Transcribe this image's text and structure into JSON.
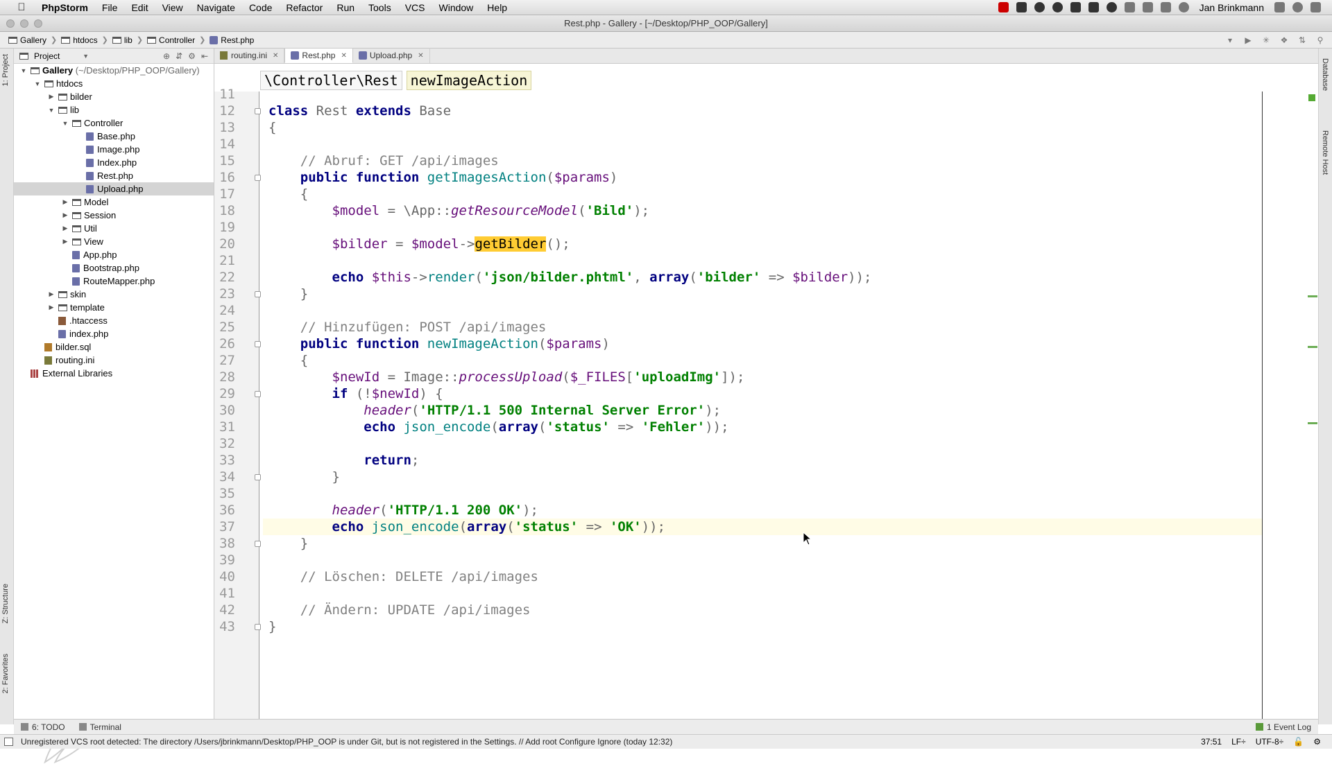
{
  "menubar": {
    "app": "PhpStorm",
    "items": [
      "File",
      "Edit",
      "View",
      "Navigate",
      "Code",
      "Refactor",
      "Run",
      "Tools",
      "VCS",
      "Window",
      "Help"
    ],
    "user": "Jan Brinkmann"
  },
  "window": {
    "title": "Rest.php - Gallery - [~/Desktop/PHP_OOP/Gallery]"
  },
  "navbar": {
    "crumbs": [
      "Gallery",
      "htdocs",
      "lib",
      "Controller",
      "Rest.php"
    ]
  },
  "project": {
    "header": "Project",
    "root_name": "Gallery",
    "root_path": "(~/Desktop/PHP_OOP/Gallery)",
    "tree": [
      {
        "label": "htdocs",
        "type": "folder",
        "depth": 1,
        "open": true
      },
      {
        "label": "bilder",
        "type": "folder",
        "depth": 2,
        "open": false
      },
      {
        "label": "lib",
        "type": "folder",
        "depth": 2,
        "open": true
      },
      {
        "label": "Controller",
        "type": "folder",
        "depth": 3,
        "open": true
      },
      {
        "label": "Base.php",
        "type": "php",
        "depth": 4
      },
      {
        "label": "Image.php",
        "type": "php",
        "depth": 4
      },
      {
        "label": "Index.php",
        "type": "php",
        "depth": 4
      },
      {
        "label": "Rest.php",
        "type": "php",
        "depth": 4
      },
      {
        "label": "Upload.php",
        "type": "php",
        "depth": 4,
        "selected": true
      },
      {
        "label": "Model",
        "type": "folder",
        "depth": 3,
        "open": false
      },
      {
        "label": "Session",
        "type": "folder",
        "depth": 3,
        "open": false
      },
      {
        "label": "Util",
        "type": "folder",
        "depth": 3,
        "open": false
      },
      {
        "label": "View",
        "type": "folder",
        "depth": 3,
        "open": false
      },
      {
        "label": "App.php",
        "type": "php",
        "depth": 3
      },
      {
        "label": "Bootstrap.php",
        "type": "php",
        "depth": 3
      },
      {
        "label": "RouteMapper.php",
        "type": "php",
        "depth": 3
      },
      {
        "label": "skin",
        "type": "folder",
        "depth": 2,
        "open": false
      },
      {
        "label": "template",
        "type": "folder",
        "depth": 2,
        "open": false
      },
      {
        "label": ".htaccess",
        "type": "ht",
        "depth": 2
      },
      {
        "label": "index.php",
        "type": "php",
        "depth": 2
      },
      {
        "label": "bilder.sql",
        "type": "sql",
        "depth": 1
      },
      {
        "label": "routing.ini",
        "type": "ini",
        "depth": 1
      },
      {
        "label": "External Libraries",
        "type": "lib",
        "depth": 0
      }
    ]
  },
  "tabs": [
    {
      "label": "routing.ini",
      "icon": "ini",
      "active": false
    },
    {
      "label": "Rest.php",
      "icon": "php",
      "active": true
    },
    {
      "label": "Upload.php",
      "icon": "php",
      "active": false
    }
  ],
  "editor": {
    "crumb_class": "\\Controller\\Rest",
    "crumb_method": "newImageAction",
    "caret_line": 37,
    "lines": [
      {
        "n": 11,
        "t": []
      },
      {
        "n": 12,
        "t": [
          [
            "kw",
            "class "
          ],
          [
            "cls",
            "Rest "
          ],
          [
            "kw",
            "extends "
          ],
          [
            "cls",
            "Base"
          ]
        ]
      },
      {
        "n": 13,
        "t": [
          [
            "cls",
            "{"
          ]
        ]
      },
      {
        "n": 14,
        "t": []
      },
      {
        "n": 15,
        "t": [
          [
            "",
            "    "
          ],
          [
            "cmt",
            "// Abruf: GET /api/images"
          ]
        ]
      },
      {
        "n": 16,
        "t": [
          [
            "",
            "    "
          ],
          [
            "kw",
            "public function "
          ],
          [
            "fn",
            "getImagesAction"
          ],
          [
            "cls",
            "("
          ],
          [
            "var",
            "$params"
          ],
          [
            "cls",
            ")"
          ]
        ]
      },
      {
        "n": 17,
        "t": [
          [
            "",
            "    "
          ],
          [
            "cls",
            "{"
          ]
        ]
      },
      {
        "n": 18,
        "t": [
          [
            "",
            "        "
          ],
          [
            "var",
            "$model "
          ],
          [
            "cls",
            "= \\App::"
          ],
          [
            "stat",
            "getResourceModel"
          ],
          [
            "cls",
            "("
          ],
          [
            "str",
            "'Bild'"
          ],
          [
            "cls",
            ");"
          ]
        ]
      },
      {
        "n": 19,
        "t": []
      },
      {
        "n": 20,
        "t": [
          [
            "",
            "        "
          ],
          [
            "var",
            "$bilder "
          ],
          [
            "cls",
            "= "
          ],
          [
            "var",
            "$model"
          ],
          [
            "cls",
            "->"
          ],
          [
            "hl",
            "getBilder"
          ],
          [
            "cls",
            "();"
          ]
        ]
      },
      {
        "n": 21,
        "t": []
      },
      {
        "n": 22,
        "t": [
          [
            "",
            "        "
          ],
          [
            "kw",
            "echo "
          ],
          [
            "var",
            "$this"
          ],
          [
            "cls",
            "->"
          ],
          [
            "fn",
            "render"
          ],
          [
            "cls",
            "("
          ],
          [
            "str",
            "'json/bilder.phtml'"
          ],
          [
            "cls",
            ", "
          ],
          [
            "kw",
            "array"
          ],
          [
            "cls",
            "("
          ],
          [
            "str",
            "'bilder'"
          ],
          [
            "cls",
            " => "
          ],
          [
            "var",
            "$bilder"
          ],
          [
            "cls",
            "));"
          ]
        ]
      },
      {
        "n": 23,
        "t": [
          [
            "",
            "    "
          ],
          [
            "cls",
            "}"
          ]
        ]
      },
      {
        "n": 24,
        "t": []
      },
      {
        "n": 25,
        "t": [
          [
            "",
            "    "
          ],
          [
            "cmt",
            "// Hinzufügen: POST /api/images"
          ]
        ]
      },
      {
        "n": 26,
        "t": [
          [
            "",
            "    "
          ],
          [
            "kw",
            "public function "
          ],
          [
            "fn",
            "newImageAction"
          ],
          [
            "cls",
            "("
          ],
          [
            "var",
            "$params"
          ],
          [
            "cls",
            ")"
          ]
        ]
      },
      {
        "n": 27,
        "t": [
          [
            "",
            "    "
          ],
          [
            "cls",
            "{"
          ]
        ]
      },
      {
        "n": 28,
        "t": [
          [
            "",
            "        "
          ],
          [
            "var",
            "$newId "
          ],
          [
            "cls",
            "= Image::"
          ],
          [
            "stat",
            "processUpload"
          ],
          [
            "cls",
            "("
          ],
          [
            "var",
            "$_FILES"
          ],
          [
            "cls",
            "["
          ],
          [
            "str",
            "'uploadImg'"
          ],
          [
            "cls",
            "]);"
          ]
        ]
      },
      {
        "n": 29,
        "t": [
          [
            "",
            "        "
          ],
          [
            "kw",
            "if "
          ],
          [
            "cls",
            "(!"
          ],
          [
            "var",
            "$newId"
          ],
          [
            "cls",
            ") {"
          ]
        ]
      },
      {
        "n": 30,
        "t": [
          [
            "",
            "            "
          ],
          [
            "stat",
            "header"
          ],
          [
            "cls",
            "("
          ],
          [
            "str",
            "'HTTP/1.1 500 Internal Server Error'"
          ],
          [
            "cls",
            ");"
          ]
        ]
      },
      {
        "n": 31,
        "t": [
          [
            "",
            "            "
          ],
          [
            "kw",
            "echo "
          ],
          [
            "fn",
            "json_encode"
          ],
          [
            "cls",
            "("
          ],
          [
            "kw",
            "array"
          ],
          [
            "cls",
            "("
          ],
          [
            "str",
            "'status'"
          ],
          [
            "cls",
            " => "
          ],
          [
            "str",
            "'Fehler'"
          ],
          [
            "cls",
            "));"
          ]
        ]
      },
      {
        "n": 32,
        "t": []
      },
      {
        "n": 33,
        "t": [
          [
            "",
            "            "
          ],
          [
            "kw",
            "return"
          ],
          [
            "cls",
            ";"
          ]
        ]
      },
      {
        "n": 34,
        "t": [
          [
            "",
            "        "
          ],
          [
            "cls",
            "}"
          ]
        ]
      },
      {
        "n": 35,
        "t": []
      },
      {
        "n": 36,
        "t": [
          [
            "",
            "        "
          ],
          [
            "stat",
            "header"
          ],
          [
            "cls",
            "("
          ],
          [
            "str",
            "'HTTP/1.1 200 OK'"
          ],
          [
            "cls",
            ");"
          ]
        ]
      },
      {
        "n": 37,
        "t": [
          [
            "",
            "        "
          ],
          [
            "kw",
            "echo "
          ],
          [
            "fn",
            "json_encode"
          ],
          [
            "cls",
            "("
          ],
          [
            "kw",
            "array"
          ],
          [
            "cls",
            "("
          ],
          [
            "str",
            "'status'"
          ],
          [
            "cls",
            " => "
          ],
          [
            "str",
            "'OK'"
          ],
          [
            "cls",
            "));"
          ]
        ]
      },
      {
        "n": 38,
        "t": [
          [
            "",
            "    "
          ],
          [
            "cls",
            "}"
          ]
        ]
      },
      {
        "n": 39,
        "t": []
      },
      {
        "n": 40,
        "t": [
          [
            "",
            "    "
          ],
          [
            "cmt",
            "// Löschen: DELETE /api/images"
          ]
        ]
      },
      {
        "n": 41,
        "t": []
      },
      {
        "n": 42,
        "t": [
          [
            "",
            "    "
          ],
          [
            "cmt",
            "// Ändern: UPDATE /api/images"
          ]
        ]
      },
      {
        "n": 43,
        "t": [
          [
            "cls",
            "}"
          ]
        ]
      }
    ],
    "fold_lines": [
      12,
      16,
      23,
      26,
      29,
      34,
      38,
      43
    ]
  },
  "left_strip": {
    "project": "1: Project",
    "structure": "Z: Structure",
    "favorites": "2: Favorites"
  },
  "right_strip": {
    "database": "Database",
    "remote": "Remote Host"
  },
  "bottom": {
    "todo": "6: TODO",
    "terminal": "Terminal",
    "event_log": "1 Event Log"
  },
  "status": {
    "message": "Unregistered VCS root detected: The directory /Users/jbrinkmann/Desktop/PHP_OOP is under Git, but is not registered in the Settings. // Add root  Configure  Ignore (today 12:32)",
    "position": "37:51",
    "line_sep": "LF÷",
    "encoding": "UTF-8÷"
  }
}
